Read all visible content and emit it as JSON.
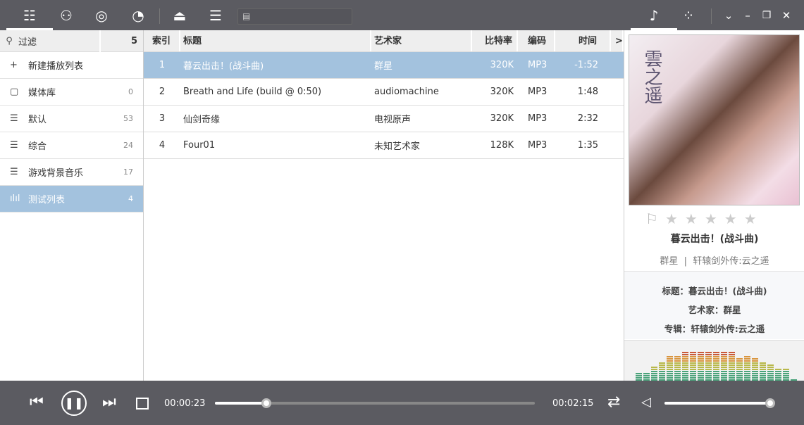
{
  "toolbar": {
    "icons": [
      "playlist-icon",
      "user-icon",
      "disc-icon",
      "gauge-icon",
      "eject-icon",
      "equalizer-icon"
    ],
    "search_icon": "document-icon",
    "right_icons": [
      "music-note-icon",
      "apps-icon",
      "chevron-down-icon",
      "minimize-icon",
      "restore-icon",
      "close-icon"
    ]
  },
  "sidebar": {
    "filter_label": "过滤",
    "filter_count": "5",
    "items": [
      {
        "icon": "plus-icon",
        "label": "新建播放列表",
        "count": ""
      },
      {
        "icon": "library-icon",
        "label": "媒体库",
        "count": "0"
      },
      {
        "icon": "list-icon",
        "label": "默认",
        "count": "53"
      },
      {
        "icon": "list-icon",
        "label": "综合",
        "count": "24"
      },
      {
        "icon": "list-icon",
        "label": "游戏背景音乐",
        "count": "17"
      },
      {
        "icon": "bars-icon",
        "label": "测试列表",
        "count": "4",
        "selected": true
      }
    ]
  },
  "table": {
    "columns": [
      "索引",
      "标题",
      "艺术家",
      "比特率",
      "编码",
      "时间",
      ">"
    ],
    "rows": [
      [
        "1",
        "暮云出击！(战斗曲)",
        "群星",
        "320K",
        "MP3",
        "-1:52"
      ],
      [
        "2",
        "Breath and Life (build @ 0:50)",
        "audiomachine",
        "320K",
        "MP3",
        "1:48"
      ],
      [
        "3",
        "仙剑奇缘",
        "电视原声",
        "320K",
        "MP3",
        "2:32"
      ],
      [
        "4",
        "Four01",
        "未知艺术家",
        "128K",
        "MP3",
        "1:35"
      ]
    ]
  },
  "now": {
    "art_text": "雲之遥",
    "rating": 0,
    "title": "暮云出击！(战斗曲)",
    "subtitle": "群星  |  轩辕剑外传:云之遥",
    "info": [
      "标题：暮云出击！(战斗曲)",
      "艺术家：群星",
      "专辑：轩辕剑外传:云之遥"
    ]
  },
  "player": {
    "elapsed": "00:00:23",
    "total": "00:02:15",
    "progress_percent": 16,
    "volume_percent": 100,
    "state": "playing"
  }
}
